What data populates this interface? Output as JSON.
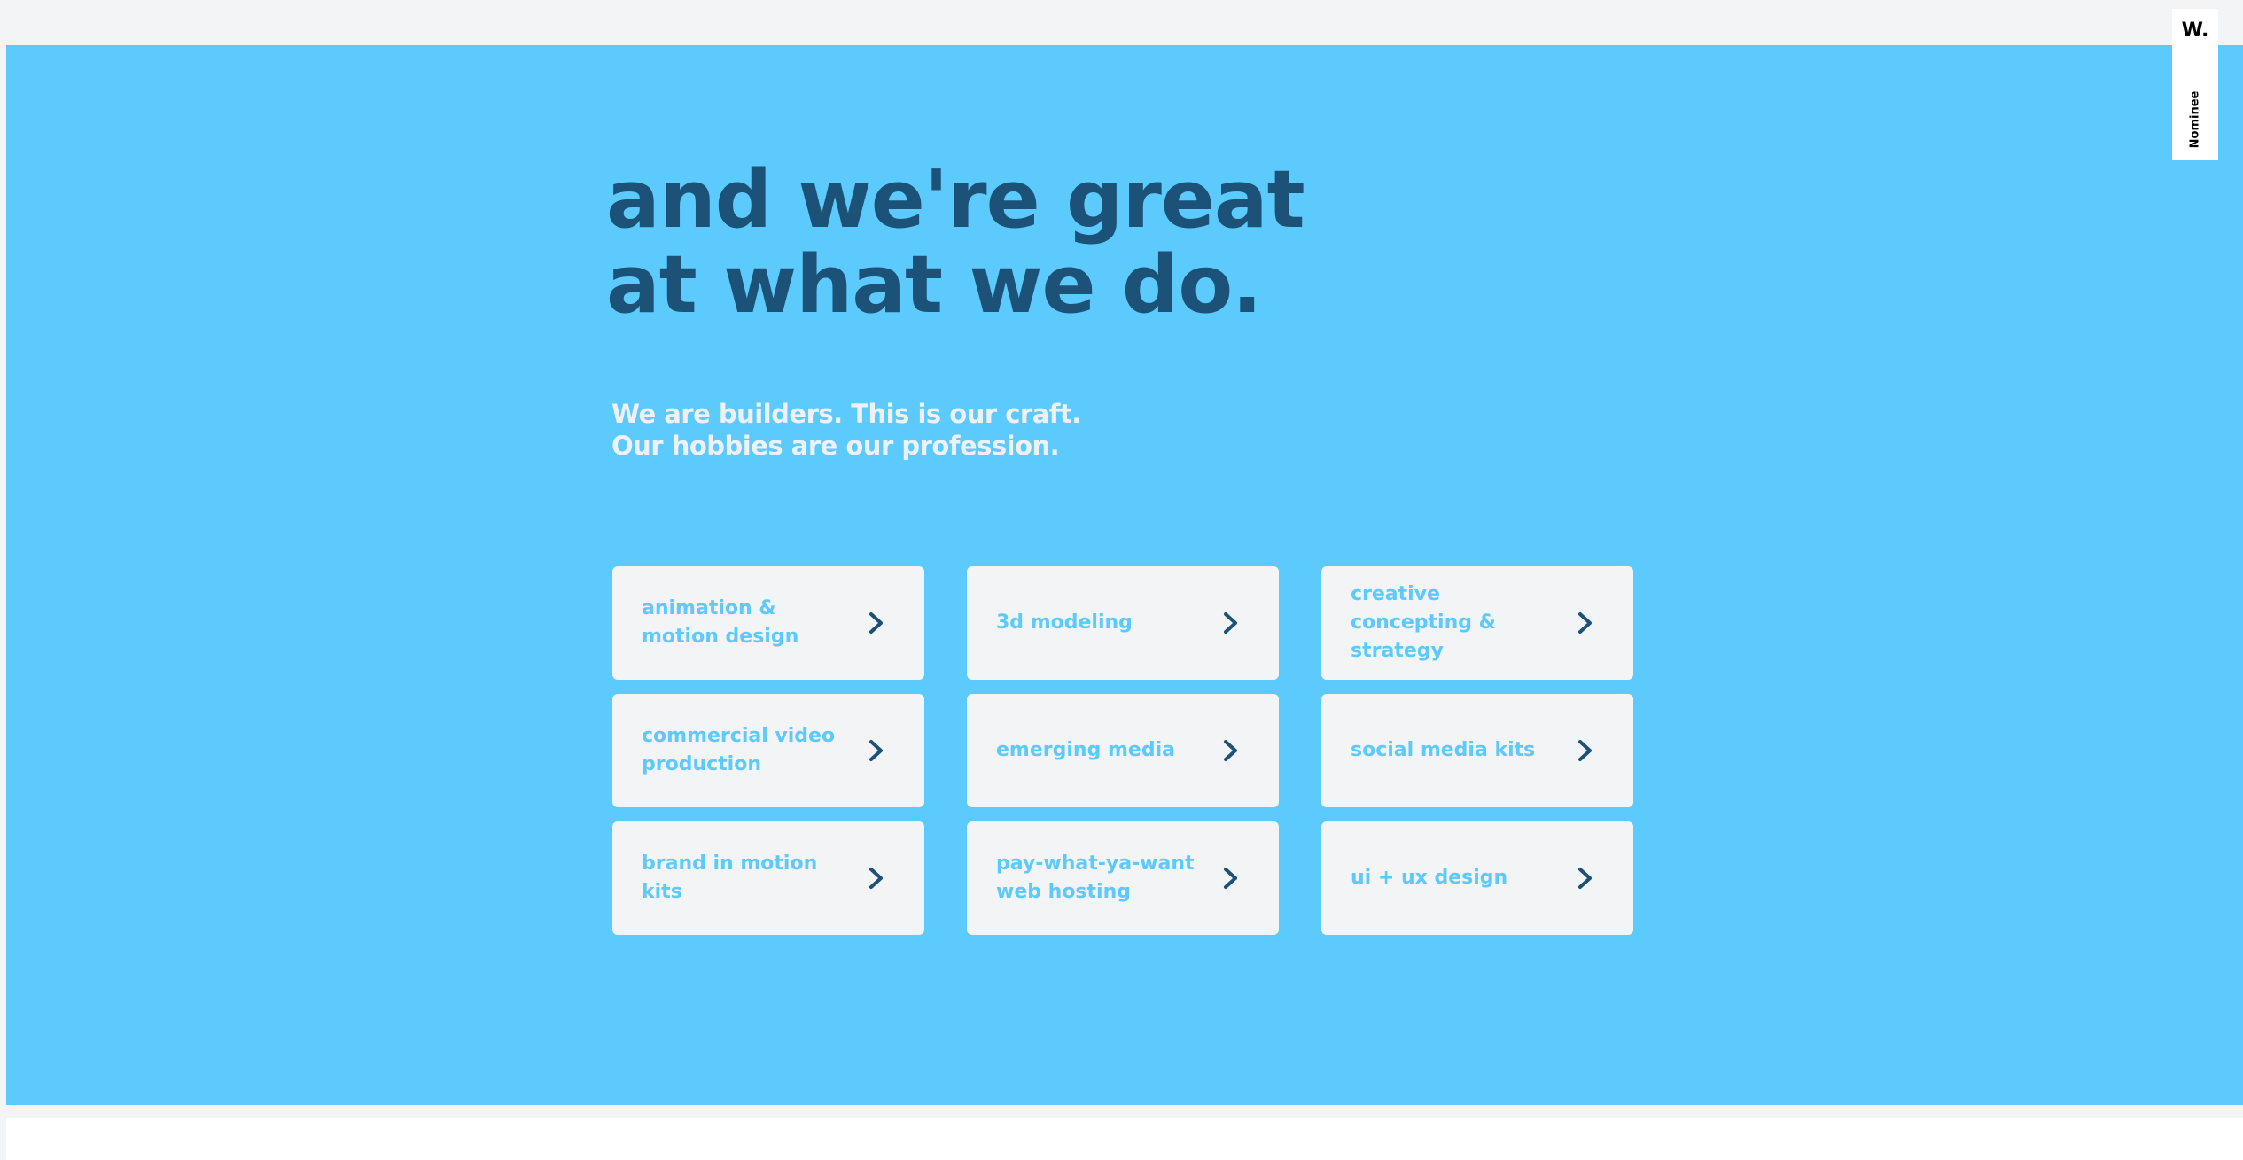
{
  "colors": {
    "hero_background": "#5ccafc",
    "headline": "#1c5277",
    "subhead": "#eef2f6",
    "card_background": "#f2f4f6",
    "card_label": "#5ccafc",
    "arrow": "#1c5277"
  },
  "hero": {
    "headline": {
      "line1": "and we're great",
      "line2": "at what we do."
    },
    "subhead": {
      "line1": "We are builders. This is our craft.",
      "line2": "Our hobbies are our profession."
    }
  },
  "services": [
    {
      "label": "animation & motion design",
      "icon": "chevron-right-icon"
    },
    {
      "label": "3d modeling",
      "icon": "chevron-right-icon"
    },
    {
      "label": "creative concepting & strategy",
      "icon": "chevron-right-icon"
    },
    {
      "label": "commercial video production",
      "icon": "chevron-right-icon"
    },
    {
      "label": "emerging media",
      "icon": "chevron-right-icon"
    },
    {
      "label": "social media kits",
      "icon": "chevron-right-icon"
    },
    {
      "label": "brand in motion kits",
      "icon": "chevron-right-icon"
    },
    {
      "label": "pay-what-ya-want web hosting",
      "icon": "chevron-right-icon"
    },
    {
      "label": "ui + ux design",
      "icon": "chevron-right-icon"
    }
  ],
  "awards_badge": {
    "logo": "W.",
    "label": "Nominee"
  }
}
